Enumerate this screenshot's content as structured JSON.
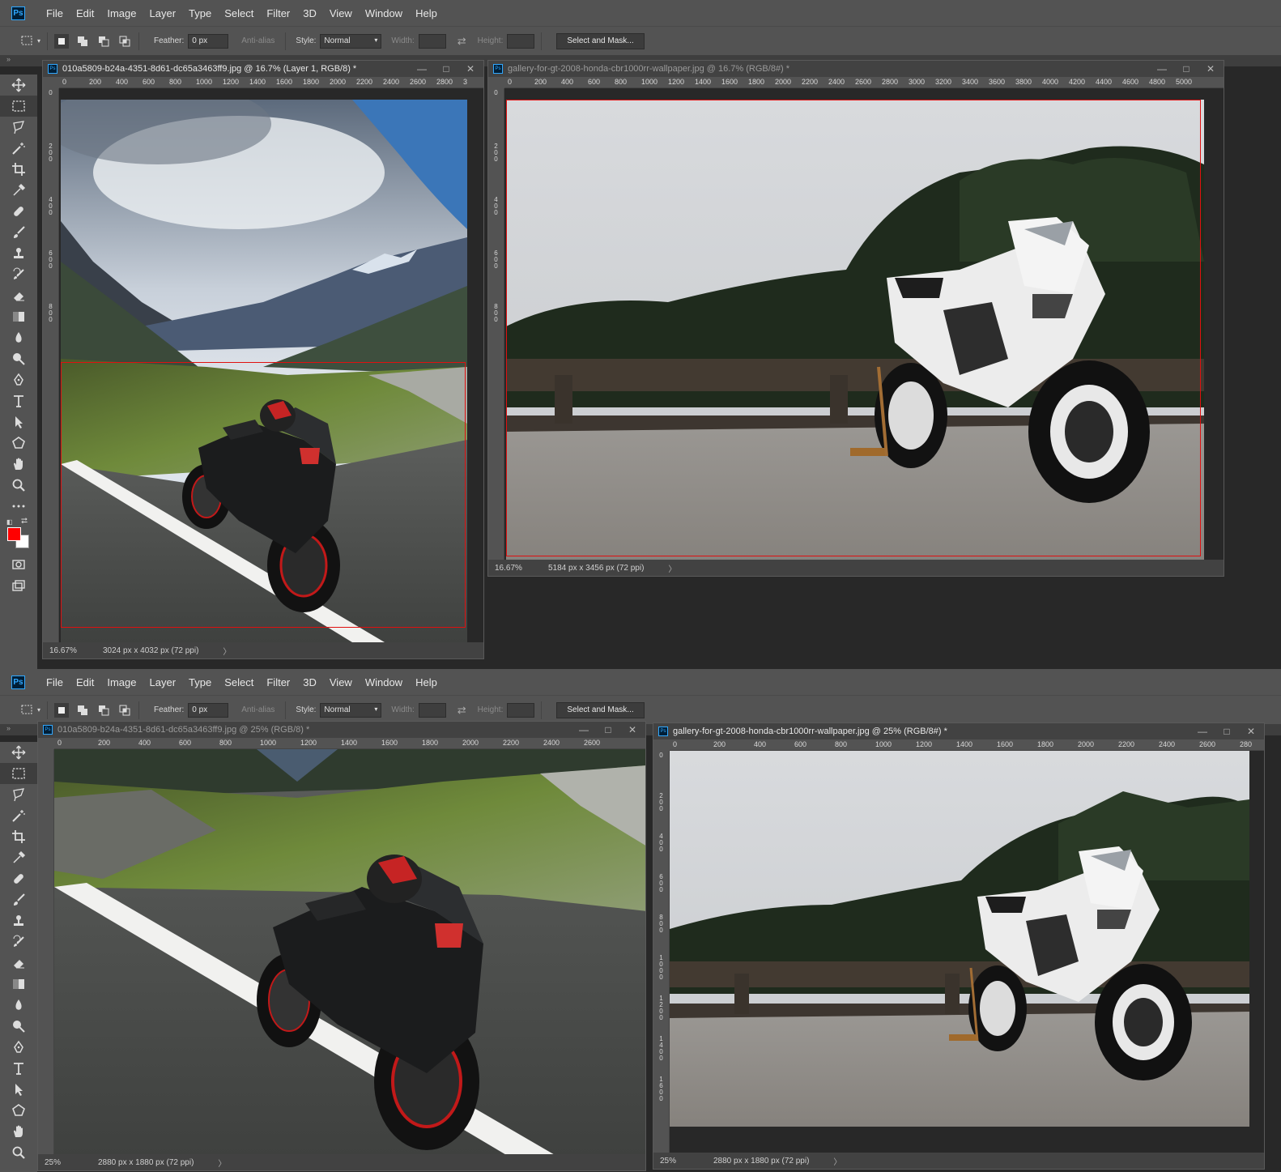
{
  "menu": {
    "app_logo": "Ps",
    "items": [
      "File",
      "Edit",
      "Image",
      "Layer",
      "Type",
      "Select",
      "Filter",
      "3D",
      "View",
      "Window",
      "Help"
    ]
  },
  "options": {
    "feather_label": "Feather:",
    "feather_value": "0 px",
    "antialias_label": "Anti-alias",
    "style_label": "Style:",
    "style_value": "Normal",
    "width_label": "Width:",
    "height_label": "Height:",
    "select_mask_label": "Select and Mask..."
  },
  "colors": {
    "foreground": "#ff0000",
    "background": "#ffffff",
    "selection": "#e01010",
    "accent": "#31a8ff"
  },
  "tools": [
    "move-icon",
    "marquee-icon",
    "lasso-icon",
    "magic-wand-icon",
    "crop-icon",
    "eyedropper-icon",
    "healing-icon",
    "brush-icon",
    "stamp-icon",
    "history-brush-icon",
    "eraser-icon",
    "gradient-icon",
    "blur-icon",
    "dodge-icon",
    "pen-icon",
    "type-icon",
    "path-select-icon",
    "shape-icon",
    "hand-icon",
    "zoom-icon",
    "more-icon"
  ],
  "top": {
    "doc1": {
      "title": "010a5809-b24a-4351-8d61-dc65a3463ff9.jpg @ 16.7% (Layer 1, RGB/8) *",
      "zoom": "16.67%",
      "size": "3024 px x 4032 px (72 ppi)",
      "ruler": [
        "0",
        "200",
        "400",
        "600",
        "800",
        "1000",
        "1200",
        "1400",
        "1600",
        "1800",
        "2000",
        "2200",
        "2400",
        "2600",
        "2800",
        "3"
      ],
      "ruler_v": [
        "0",
        "2 0 0",
        "4 0 0",
        "6 0 0",
        "8 0 0"
      ]
    },
    "doc2": {
      "title": "gallery-for-gt-2008-honda-cbr1000rr-wallpaper.jpg @ 16.7% (RGB/8#) *",
      "zoom": "16.67%",
      "size": "5184 px x 3456 px (72 ppi)",
      "ruler": [
        "0",
        "200",
        "400",
        "600",
        "800",
        "1000",
        "1200",
        "1400",
        "1600",
        "1800",
        "2000",
        "2200",
        "2400",
        "2600",
        "2800",
        "3000",
        "3200",
        "3400",
        "3600",
        "3800",
        "4000",
        "4200",
        "4400",
        "4600",
        "4800",
        "5000"
      ],
      "ruler_v": [
        "0",
        "2 0 0",
        "4 0 0",
        "6 0 0",
        "8 0 0"
      ]
    }
  },
  "bottom": {
    "doc1": {
      "title": "010a5809-b24a-4351-8d61-dc65a3463ff9.jpg @ 25% (RGB/8) *",
      "zoom": "25%",
      "size": "2880 px x 1880 px (72 ppi)",
      "ruler": [
        "0",
        "200",
        "400",
        "600",
        "800",
        "1000",
        "1200",
        "1400",
        "1600",
        "1800",
        "2000",
        "2200",
        "2400",
        "2600"
      ]
    },
    "doc2": {
      "title": "gallery-for-gt-2008-honda-cbr1000rr-wallpaper.jpg @ 25% (RGB/8#) *",
      "zoom": "25%",
      "size": "2880 px x 1880 px (72 ppi)",
      "ruler": [
        "0",
        "200",
        "400",
        "600",
        "800",
        "1000",
        "1200",
        "1400",
        "1600",
        "1800",
        "2000",
        "2200",
        "2400",
        "2600",
        "280"
      ],
      "ruler_v": [
        "0",
        "2 0 0",
        "4 0 0",
        "6 0 0",
        "8 0 0",
        "1 0 0 0",
        "1 2 0 0",
        "1 4 0 0",
        "1 6 0 0"
      ]
    }
  }
}
